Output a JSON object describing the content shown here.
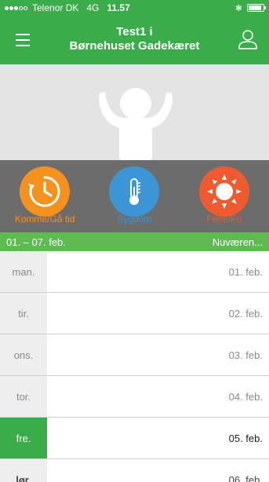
{
  "status_bar": {
    "carrier": "Telenor DK",
    "network": "4G",
    "time": "11.57"
  },
  "header": {
    "title_line1": "Test1 i",
    "title_line2": "Børnehuset Gadekæret",
    "menu_icon": "hamburger-menu-icon",
    "user_icon": "user-profile-icon"
  },
  "actions": [
    {
      "label": "Komme/Gå tid",
      "icon": "clock-arrow-icon",
      "color": "#f5921e",
      "label_color": "#f5921e"
    },
    {
      "label": "Sygdom",
      "icon": "thermometer-icon",
      "color": "#3c96d6",
      "label_color": "#3c96d6"
    },
    {
      "label": "Ferie/Fri",
      "icon": "sun-icon",
      "color": "#ef5a2f",
      "label_color": "#ef5a2f"
    }
  ],
  "week": {
    "range": "01. – 07. feb.",
    "current_label": "Nuværen..."
  },
  "days": [
    {
      "name": "man.",
      "date": "01. feb."
    },
    {
      "name": "tir.",
      "date": "02. feb."
    },
    {
      "name": "ons.",
      "date": "03. feb."
    },
    {
      "name": "tor.",
      "date": "04. feb."
    },
    {
      "name": "fre.",
      "date": "05. feb."
    },
    {
      "name": "lør.",
      "date": "06. feb."
    }
  ],
  "colors": {
    "brand_green": "#3aac4a",
    "week_bar_green": "#5dbb52",
    "action_bar_gray": "#6c6c6c"
  }
}
